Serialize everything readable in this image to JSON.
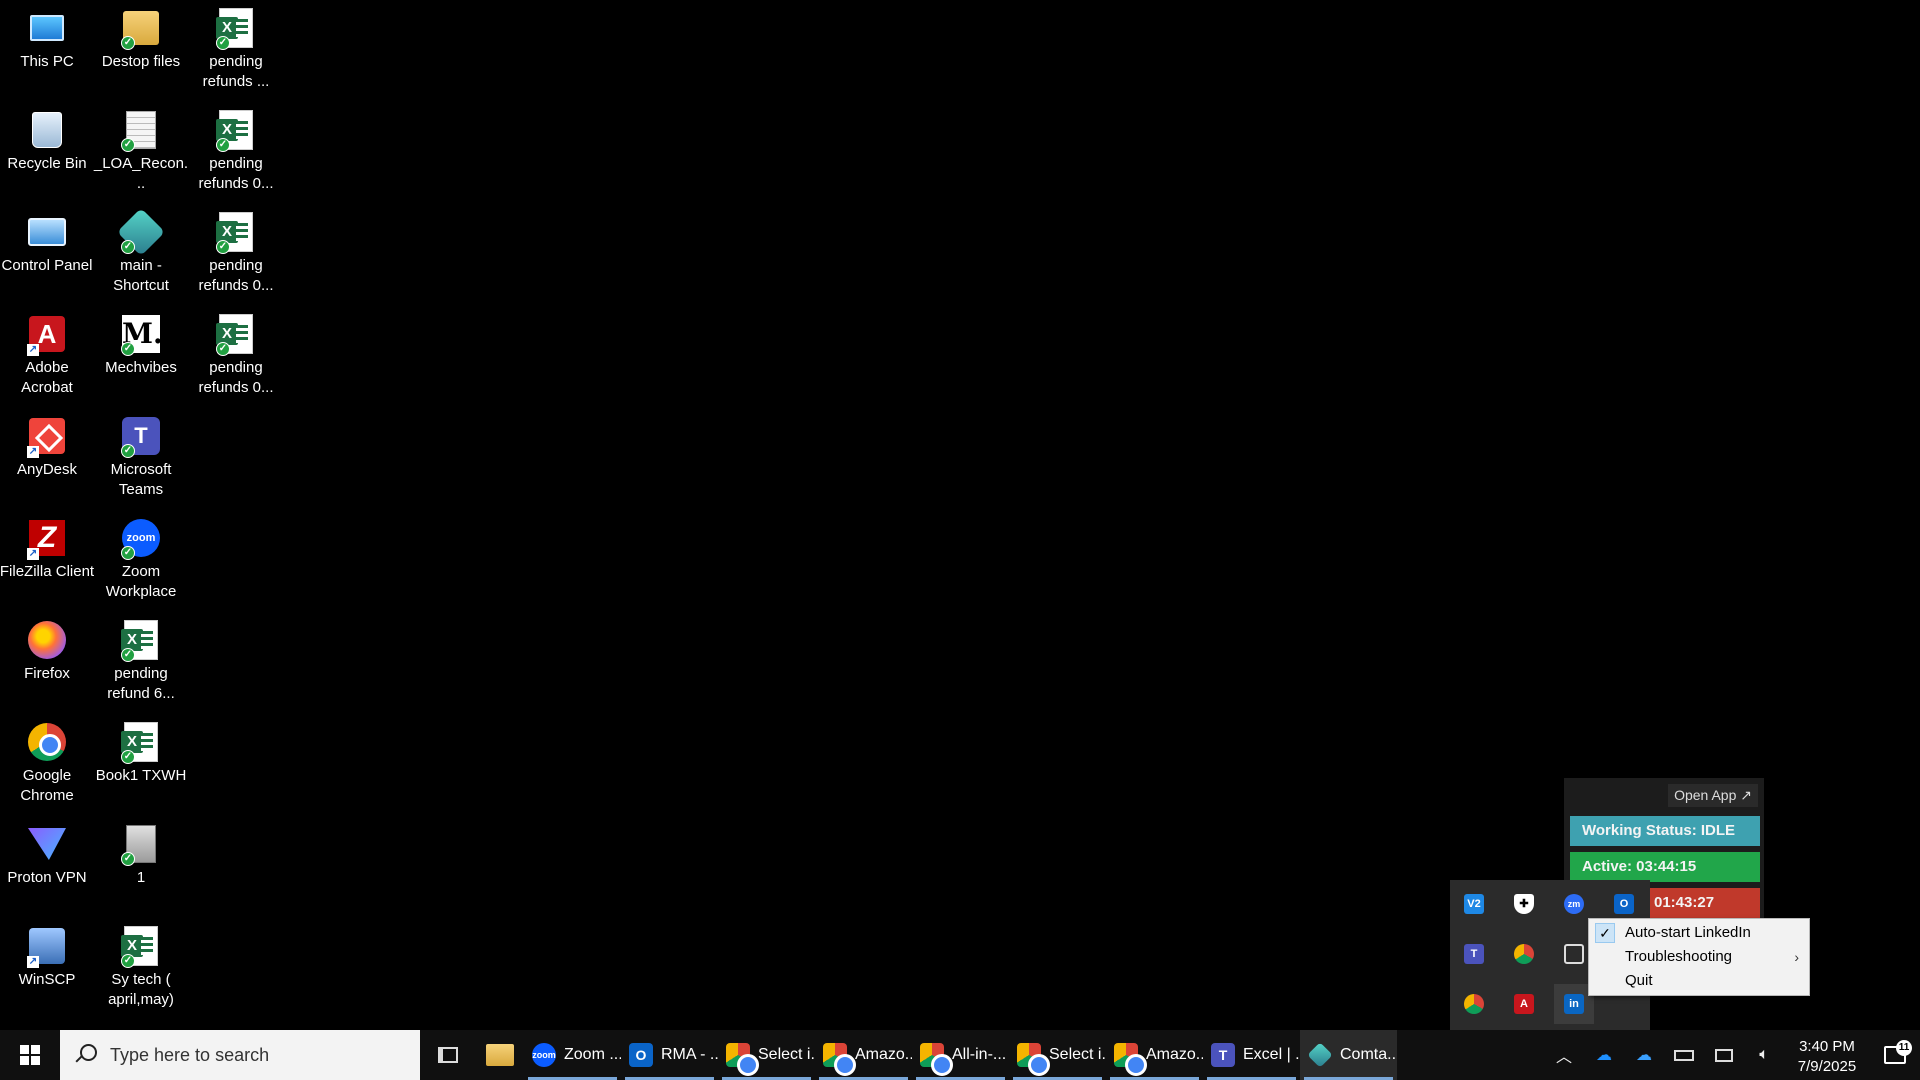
{
  "desktop": {
    "icons": [
      {
        "label": "This PC",
        "icon": "computer-icon"
      },
      {
        "label": "Recycle Bin",
        "icon": "recycle-bin-icon"
      },
      {
        "label": "Control Panel",
        "icon": "control-panel-icon"
      },
      {
        "label": "Adobe Acrobat",
        "icon": "adobe-acrobat-icon"
      },
      {
        "label": "AnyDesk",
        "icon": "anydesk-icon"
      },
      {
        "label": "FileZilla Client",
        "icon": "filezilla-icon"
      },
      {
        "label": "Firefox",
        "icon": "firefox-icon"
      },
      {
        "label": "Google Chrome",
        "icon": "chrome-icon"
      },
      {
        "label": "Proton VPN",
        "icon": "proton-vpn-icon"
      },
      {
        "label": "WinSCP",
        "icon": "winscp-icon"
      },
      {
        "label": "Destop files",
        "icon": "folder-icon"
      },
      {
        "label": "_LOA_Recon...",
        "icon": "document-icon"
      },
      {
        "label": "main - Shortcut",
        "icon": "main-app-icon"
      },
      {
        "label": "Mechvibes",
        "icon": "mechvibes-icon"
      },
      {
        "label": "Microsoft Teams",
        "icon": "teams-icon"
      },
      {
        "label": "Zoom Workplace",
        "icon": "zoom-icon"
      },
      {
        "label": "pending refund 6...",
        "icon": "excel-file-icon"
      },
      {
        "label": "Book1 TXWH",
        "icon": "excel-file-icon"
      },
      {
        "label": "1",
        "icon": "file-icon"
      },
      {
        "label": "Sy tech ( april,may)",
        "icon": "excel-file-icon"
      },
      {
        "label": "pending refunds ...",
        "icon": "excel-file-icon"
      },
      {
        "label": "pending refunds 0...",
        "icon": "excel-file-icon"
      },
      {
        "label": "pending refunds 0...",
        "icon": "excel-file-icon"
      },
      {
        "label": "pending refunds 0...",
        "icon": "excel-file-icon"
      }
    ]
  },
  "tracker": {
    "open_app_label": "Open App ↗",
    "working_status": "Working Status: IDLE",
    "active": "Active: 03:44:15",
    "idle_time": "01:43:27",
    "colors": {
      "status": "#3ea1b0",
      "active": "#21a64a",
      "idle": "#c0392b"
    }
  },
  "context_menu": {
    "items": [
      {
        "label": "Auto-start LinkedIn",
        "checked": true
      },
      {
        "label": "Troubleshooting",
        "submenu": true
      },
      {
        "label": "Quit"
      }
    ]
  },
  "tray_overflow": {
    "icons": [
      "v2-icon",
      "shield-icon",
      "zoom-tray-icon",
      "outlook-tray-icon",
      "teams-tray-icon",
      "chrome-error-icon",
      "screen-capture-icon",
      "chrome-tray-icon",
      "acrobat-tray-icon",
      "linkedin-icon"
    ]
  },
  "taskbar": {
    "search_placeholder": "Type here to search",
    "apps": [
      {
        "label": "Zoom ...",
        "icon": "zoom-icon",
        "color": "#0b5cff",
        "glyph": "zoom"
      },
      {
        "label": "RMA - ...",
        "icon": "outlook-icon",
        "color": "#0a64c8",
        "glyph": "O"
      },
      {
        "label": "Select i...",
        "icon": "chrome-icon",
        "color": "#db4437",
        "glyph": ""
      },
      {
        "label": "Amazo...",
        "icon": "chrome-icon",
        "color": "#db4437",
        "glyph": ""
      },
      {
        "label": "All-in-...",
        "icon": "chrome-icon",
        "color": "#db4437",
        "glyph": ""
      },
      {
        "label": "Select i...",
        "icon": "chrome-icon",
        "color": "#db4437",
        "glyph": ""
      },
      {
        "label": "Amazo...",
        "icon": "chrome-icon",
        "color": "#db4437",
        "glyph": ""
      },
      {
        "label": "Excel | ...",
        "icon": "teams-icon",
        "color": "#4b53bc",
        "glyph": "T"
      },
      {
        "label": "Comta...",
        "icon": "comta-icon",
        "color": "#4db6ac",
        "glyph": ""
      }
    ],
    "clock_time": "3:40 PM",
    "clock_date": "7/9/2025",
    "notification_count": "11"
  }
}
